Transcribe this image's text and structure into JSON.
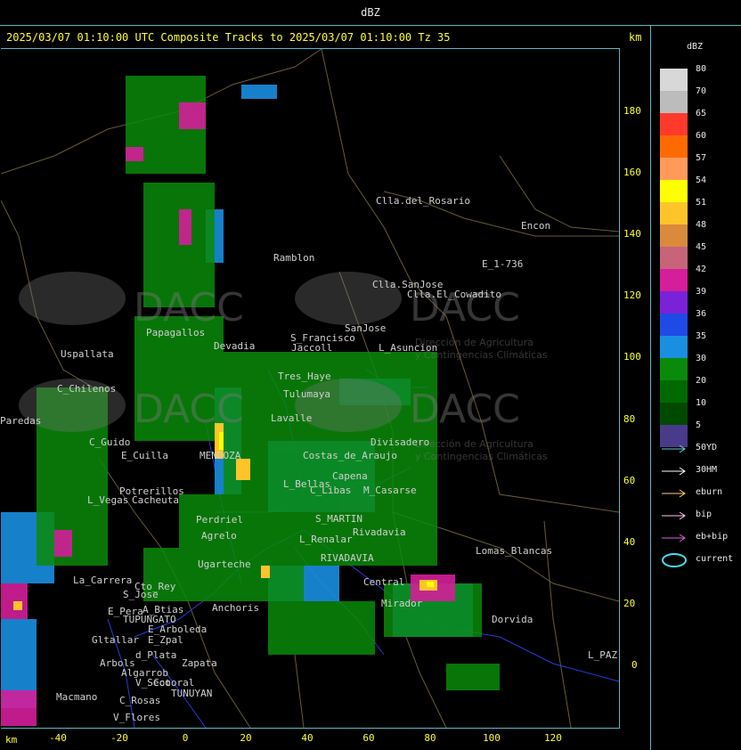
{
  "header": {
    "title": "dBZ"
  },
  "subtitle": "2025/03/07 01:10:00 UTC Composite Tracks to 2025/03/07 01:10:00 Tz 35",
  "km_top": "km",
  "km_bottom": "km",
  "y_ticks": [
    "180",
    "160",
    "140",
    "120",
    "100",
    "80",
    "60",
    "40",
    "20",
    "0"
  ],
  "x_ticks": [
    "-40",
    "-20",
    "0",
    "20",
    "40",
    "60",
    "80",
    "100",
    "120"
  ],
  "legend": {
    "title": "dBZ",
    "levels": [
      {
        "label": "80",
        "color": "#d8d8d8"
      },
      {
        "label": "70",
        "color": "#bcbcbc"
      },
      {
        "label": "65",
        "color": "#ff3a2a"
      },
      {
        "label": "60",
        "color": "#ff6a00"
      },
      {
        "label": "57",
        "color": "#ff9a5a"
      },
      {
        "label": "54",
        "color": "#ffff00"
      },
      {
        "label": "51",
        "color": "#ffc42a"
      },
      {
        "label": "48",
        "color": "#d98a3a"
      },
      {
        "label": "45",
        "color": "#c8647a"
      },
      {
        "label": "42",
        "color": "#d41e9a"
      },
      {
        "label": "39",
        "color": "#7a22d8"
      },
      {
        "label": "36",
        "color": "#1e4ae6"
      },
      {
        "label": "35",
        "color": "#1a8ee0"
      },
      {
        "label": "30",
        "color": "#0a8a0a"
      },
      {
        "label": "20",
        "color": "#006a00"
      },
      {
        "label": "10",
        "color": "#004a00"
      },
      {
        "label": "5",
        "color": "#4a3a8a"
      }
    ],
    "tracks": [
      {
        "label": "50YD",
        "color": "#5fd0d8"
      },
      {
        "label": "30HM",
        "color": "#ffffff"
      },
      {
        "label": "eburn",
        "color": "#ffd27a"
      },
      {
        "label": "bip",
        "color": "#ffc8e6"
      },
      {
        "label": "eb+bip",
        "color": "#e060e0"
      },
      {
        "label": "current",
        "color": "#40e0e8"
      }
    ]
  },
  "places": [
    "Clla.del_Rosario",
    "Encon",
    "E_1-736",
    "Ramblon",
    "Clla.SanJose",
    "Clla.El_Cowadito",
    "S_Francisco",
    "Jaccoll",
    "SanJose",
    "L_Asuncion",
    "Uspallata",
    "Papagallos",
    "Devadia",
    "C_Chilenos",
    "Paredas",
    "C_Guido",
    "E_Cuilla",
    "MENDOZA",
    "Tres_Haye",
    "Tulumaya",
    "Lavalle",
    "Divisadero",
    "Costas_de_Araujo",
    "L_Bellas",
    "Capena",
    "C_Libas",
    "M_Casarse",
    "Potrerillos",
    "Cacheuta",
    "L_Vegas",
    "Perdriel",
    "Agrelo",
    "S_MARTIN",
    "Rivadavia",
    "L_Renalar",
    "Lomas_Blancas",
    "Ugarteche",
    "RIVADAVIA",
    "La_Carrera",
    "Cto_Rey",
    "S_Jose",
    "E_Pera",
    "A_Btias",
    "Anchoris",
    "TUPUNGATO",
    "E_Arboleda",
    "Gltallar",
    "E_Zpal",
    "Central",
    "Mirador",
    "Dorvida",
    "L_PAZ",
    "Arbols",
    "d_Plata",
    "Zapata",
    "Algarrob",
    "V_Seco",
    "Cotoral",
    "TUNUYAN",
    "Macmano",
    "C_Rosas",
    "V_Flores"
  ],
  "watermark": {
    "brand": "DACC",
    "line1": "Dirección de Agricultura",
    "line2": "y Contingencias Climáticas"
  }
}
